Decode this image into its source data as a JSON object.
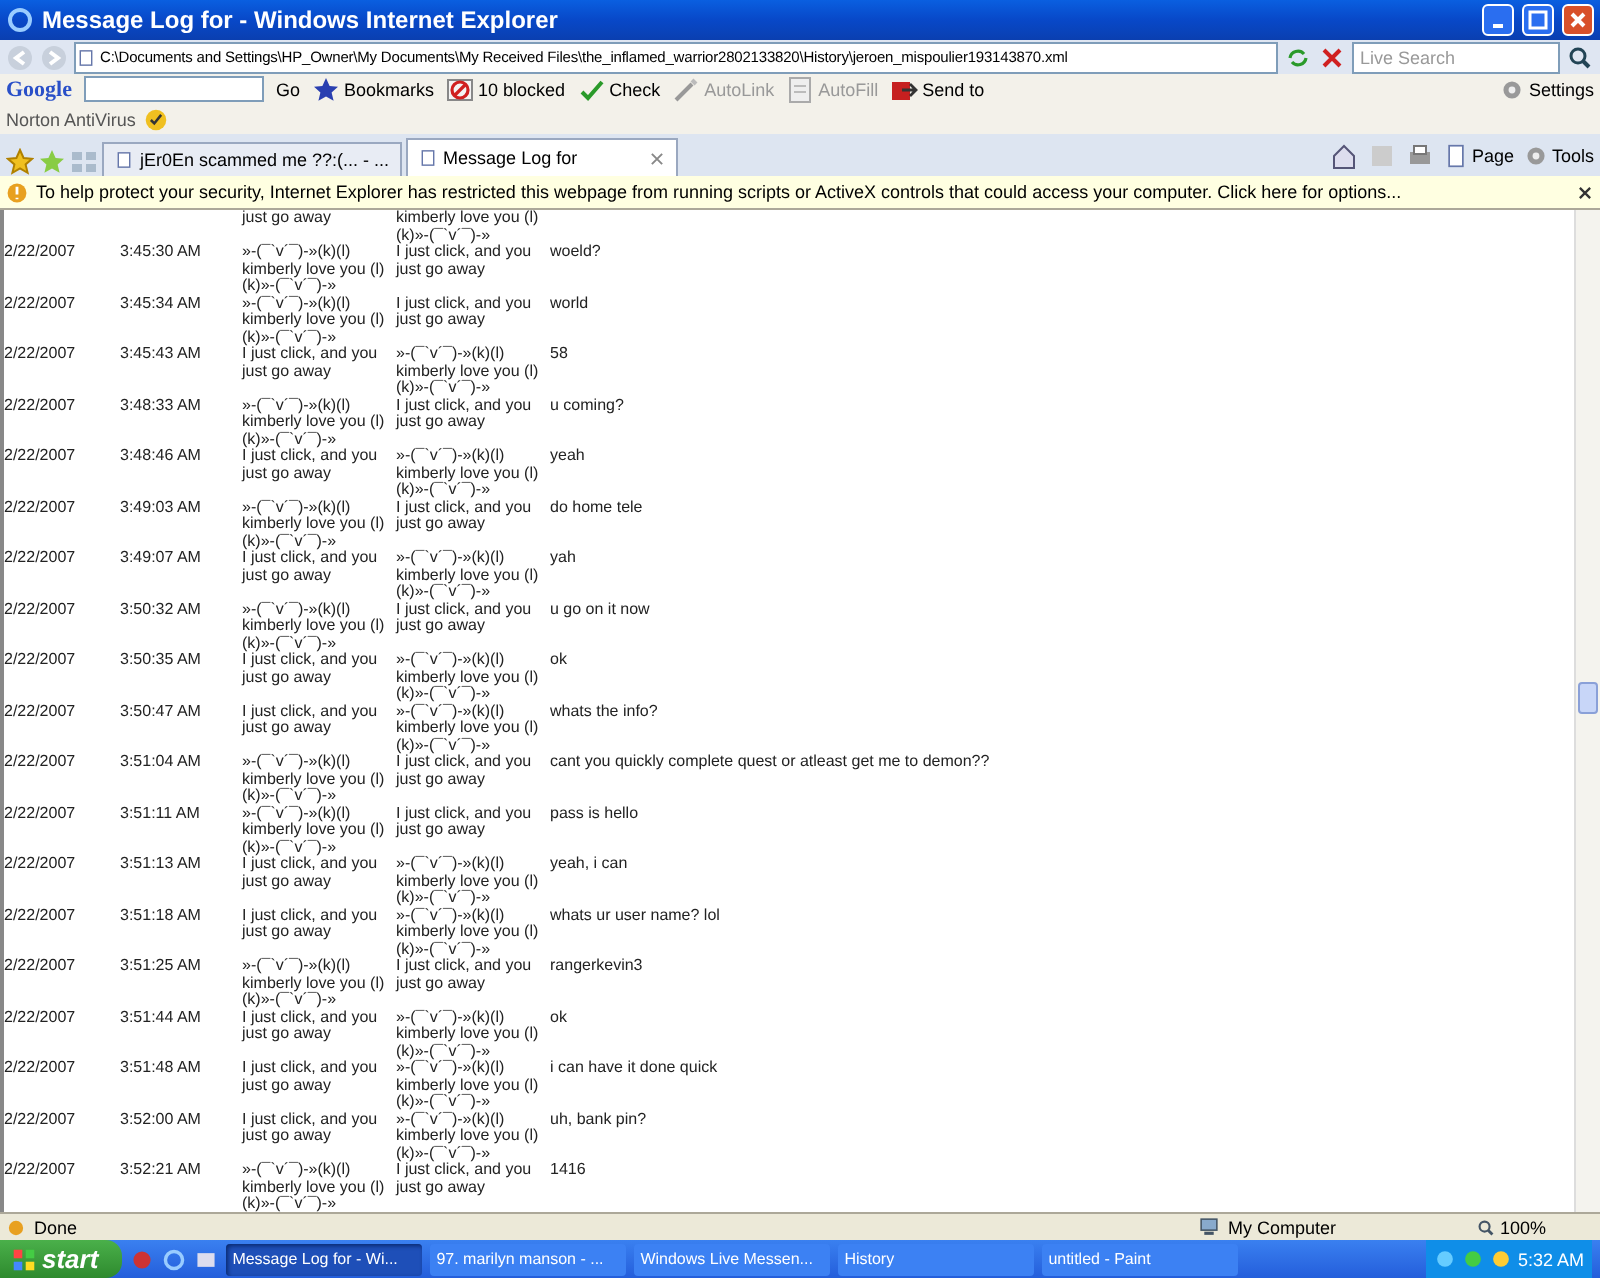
{
  "window": {
    "title": "Message Log for - Windows Internet Explorer"
  },
  "address_bar": {
    "url": "C:\\Documents and Settings\\HP_Owner\\My Documents\\My Received Files\\the_inflamed_warrior2802133820\\History\\jeroen_mispoulier193143870.xml"
  },
  "search": {
    "placeholder": "Live Search"
  },
  "google_toolbar": {
    "logo": "Google",
    "go": "Go",
    "items": [
      {
        "kind": "star",
        "label": "Bookmarks",
        "disabled": false
      },
      {
        "kind": "block",
        "label": "10 blocked",
        "disabled": false
      },
      {
        "kind": "check",
        "label": "Check",
        "disabled": false
      },
      {
        "kind": "link",
        "label": "AutoLink",
        "disabled": true
      },
      {
        "kind": "fill",
        "label": "AutoFill",
        "disabled": true
      },
      {
        "kind": "send",
        "label": "Send to",
        "disabled": false
      }
    ],
    "settings": "Settings"
  },
  "norton": {
    "label": "Norton AntiVirus"
  },
  "tabs": [
    {
      "label": "jEr0En scammed me ??:(... - ...",
      "selected": false
    },
    {
      "label": "Message Log for",
      "selected": true
    }
  ],
  "command_bar": {
    "page": "Page",
    "tools": "Tools"
  },
  "info_bar": {
    "text": "To help protect your security, Internet Explorer has restricted this webpage from running scripts or ActiveX controls that could access your computer. Click here for options..."
  },
  "log": {
    "partial_row": {
      "from": "just go away",
      "to": "kimberly love you (l)\n(k)»-(¯`v´¯)-»"
    },
    "rows": [
      {
        "date": "2/22/2007",
        "time": "3:45:30 AM",
        "from": "»-(¯`v´¯)-»(k)(l)\nkimberly love you (l)\n(k)»-(¯`v´¯)-»",
        "to": "I just click, and you\njust go away",
        "message": "woeld?"
      },
      {
        "date": "2/22/2007",
        "time": "3:45:34 AM",
        "from": "»-(¯`v´¯)-»(k)(l)\nkimberly love you (l)\n(k)»-(¯`v´¯)-»",
        "to": "I just click, and you\njust go away",
        "message": "world"
      },
      {
        "date": "2/22/2007",
        "time": "3:45:43 AM",
        "from": "I just click, and you\njust go away",
        "to": "»-(¯`v´¯)-»(k)(l)\nkimberly love you (l)\n(k)»-(¯`v´¯)-»",
        "message": "58"
      },
      {
        "date": "2/22/2007",
        "time": "3:48:33 AM",
        "from": "»-(¯`v´¯)-»(k)(l)\nkimberly love you (l)\n(k)»-(¯`v´¯)-»",
        "to": "I just click, and you\njust go away",
        "message": "u coming?"
      },
      {
        "date": "2/22/2007",
        "time": "3:48:46 AM",
        "from": "I just click, and you\njust go away",
        "to": "»-(¯`v´¯)-»(k)(l)\nkimberly love you (l)\n(k)»-(¯`v´¯)-»",
        "message": "yeah"
      },
      {
        "date": "2/22/2007",
        "time": "3:49:03 AM",
        "from": "»-(¯`v´¯)-»(k)(l)\nkimberly love you (l)\n(k)»-(¯`v´¯)-»",
        "to": "I just click, and you\njust go away",
        "message": "do home tele"
      },
      {
        "date": "2/22/2007",
        "time": "3:49:07 AM",
        "from": "I just click, and you\njust go away",
        "to": "»-(¯`v´¯)-»(k)(l)\nkimberly love you (l)\n(k)»-(¯`v´¯)-»",
        "message": "yah"
      },
      {
        "date": "2/22/2007",
        "time": "3:50:32 AM",
        "from": "»-(¯`v´¯)-»(k)(l)\nkimberly love you (l)\n(k)»-(¯`v´¯)-»",
        "to": "I just click, and you\njust go away",
        "message": "u go on it now"
      },
      {
        "date": "2/22/2007",
        "time": "3:50:35 AM",
        "from": "I just click, and you\njust go away",
        "to": "»-(¯`v´¯)-»(k)(l)\nkimberly love you (l)\n(k)»-(¯`v´¯)-»",
        "message": "ok"
      },
      {
        "date": "2/22/2007",
        "time": "3:50:47 AM",
        "from": "I just click, and you\njust go away",
        "to": "»-(¯`v´¯)-»(k)(l)\nkimberly love you (l)\n(k)»-(¯`v´¯)-»",
        "message": "whats the info?"
      },
      {
        "date": "2/22/2007",
        "time": "3:51:04 AM",
        "from": "»-(¯`v´¯)-»(k)(l)\nkimberly love you (l)\n(k)»-(¯`v´¯)-»",
        "to": "I just click, and you\njust go away",
        "message": "cant you quickly complete quest or atleast get me to demon??"
      },
      {
        "date": "2/22/2007",
        "time": "3:51:11 AM",
        "from": "»-(¯`v´¯)-»(k)(l)\nkimberly love you (l)\n(k)»-(¯`v´¯)-»",
        "to": "I just click, and you\njust go away",
        "message": "pass is hello"
      },
      {
        "date": "2/22/2007",
        "time": "3:51:13 AM",
        "from": "I just click, and you\njust go away",
        "to": "»-(¯`v´¯)-»(k)(l)\nkimberly love you (l)\n(k)»-(¯`v´¯)-»",
        "message": "yeah, i can"
      },
      {
        "date": "2/22/2007",
        "time": "3:51:18 AM",
        "from": "I just click, and you\njust go away",
        "to": "»-(¯`v´¯)-»(k)(l)\nkimberly love you (l)\n(k)»-(¯`v´¯)-»",
        "message": "whats ur user name? lol"
      },
      {
        "date": "2/22/2007",
        "time": "3:51:25 AM",
        "from": "»-(¯`v´¯)-»(k)(l)\nkimberly love you (l)\n(k)»-(¯`v´¯)-»",
        "to": "I just click, and you\njust go away",
        "message": "rangerkevin3"
      },
      {
        "date": "2/22/2007",
        "time": "3:51:44 AM",
        "from": "I just click, and you\njust go away",
        "to": "»-(¯`v´¯)-»(k)(l)\nkimberly love you (l)\n(k)»-(¯`v´¯)-»",
        "message": "ok"
      },
      {
        "date": "2/22/2007",
        "time": "3:51:48 AM",
        "from": "I just click, and you\njust go away",
        "to": "»-(¯`v´¯)-»(k)(l)\nkimberly love you (l)\n(k)»-(¯`v´¯)-»",
        "message": "i can have it done quick"
      },
      {
        "date": "2/22/2007",
        "time": "3:52:00 AM",
        "from": "I just click, and you\njust go away",
        "to": "»-(¯`v´¯)-»(k)(l)\nkimberly love you (l)\n(k)»-(¯`v´¯)-»",
        "message": "uh, bank pin?"
      },
      {
        "date": "2/22/2007",
        "time": "3:52:21 AM",
        "from": "»-(¯`v´¯)-»(k)(l)\nkimberly love you (l)\n(k)»-(¯`v´¯)-»",
        "to": "I just click, and you\njust go away",
        "message": "1416"
      }
    ]
  },
  "status_bar": {
    "text": "Done",
    "zone": "My Computer",
    "zoom": "100%"
  },
  "taskbar": {
    "start": "start",
    "tasks": [
      {
        "label": "Message Log for - Wi...",
        "selected": true
      },
      {
        "label": "97. marilyn manson - ...",
        "selected": false
      },
      {
        "label": "Windows Live Messen...",
        "selected": false
      },
      {
        "label": "History",
        "selected": false
      },
      {
        "label": "untitled - Paint",
        "selected": false
      }
    ],
    "clock": "5:32 AM"
  }
}
